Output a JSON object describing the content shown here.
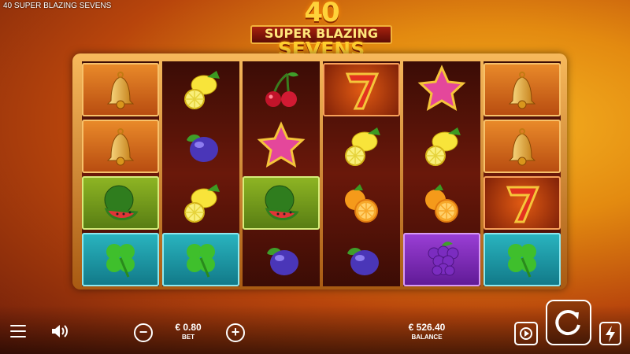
{
  "window": {
    "title": "40 SUPER BLAZING SEVENS"
  },
  "logo": {
    "number": "40",
    "line1": "SUPER BLAZING",
    "line2": "SEVENS"
  },
  "reels": [
    [
      "bell",
      "bell",
      "watermelon",
      "clover"
    ],
    [
      "lemon",
      "plum",
      "lemon",
      "clover"
    ],
    [
      "cherry",
      "star",
      "watermelon",
      "plum"
    ],
    [
      "seven",
      "lemon",
      "orange",
      "plum"
    ],
    [
      "star",
      "lemon",
      "orange",
      "grapes"
    ],
    [
      "bell",
      "bell",
      "seven",
      "clover"
    ]
  ],
  "bet": {
    "value": "€ 0.80",
    "label": "BET"
  },
  "balance": {
    "value": "€ 526.40",
    "label": "BALANCE"
  },
  "controls": {
    "menu_icon": "menu-icon",
    "sound_icon": "speaker-icon",
    "minus_symbol": "−",
    "plus_symbol": "+",
    "autoplay_icon": "autoplay-icon",
    "spin_icon": "spin-icon",
    "turbo_icon": "lightning-icon"
  }
}
